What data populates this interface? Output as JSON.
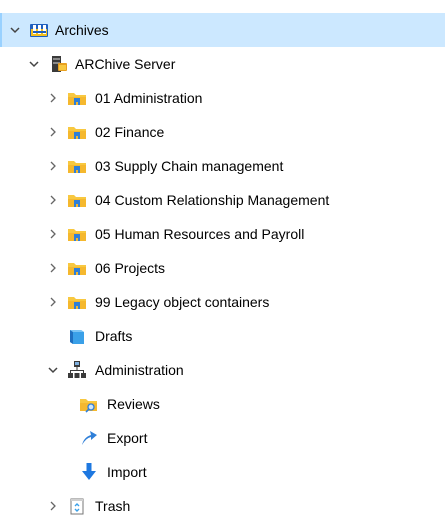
{
  "tree": {
    "root": {
      "label": "Archives",
      "icon": "archives-app-icon",
      "expanded": true,
      "selected": true,
      "selection_color": "#cce8ff"
    },
    "server": {
      "label": "ARChive Server",
      "icon": "archive-server-icon",
      "expanded": true
    },
    "cabinets": [
      {
        "label": "01 Administration",
        "icon": "cabinet-folder-icon",
        "expanded": false
      },
      {
        "label": "02 Finance",
        "icon": "cabinet-folder-icon",
        "expanded": false
      },
      {
        "label": "03 Supply Chain management",
        "icon": "cabinet-folder-icon",
        "expanded": false
      },
      {
        "label": "04 Custom Relationship Management",
        "icon": "cabinet-folder-icon",
        "expanded": false
      },
      {
        "label": "05 Human Resources and Payroll",
        "icon": "cabinet-folder-icon",
        "expanded": false
      },
      {
        "label": "06 Projects",
        "icon": "cabinet-folder-icon",
        "expanded": false
      },
      {
        "label": "99 Legacy object containers",
        "icon": "cabinet-folder-icon",
        "expanded": false
      }
    ],
    "drafts": {
      "label": "Drafts",
      "icon": "drafts-box-icon"
    },
    "administration": {
      "label": "Administration",
      "icon": "network-admin-icon",
      "expanded": true,
      "children": [
        {
          "label": "Reviews",
          "icon": "reviews-folder-icon"
        },
        {
          "label": "Export",
          "icon": "export-arrow-icon"
        },
        {
          "label": "Import",
          "icon": "import-arrow-icon"
        }
      ]
    },
    "trash": {
      "label": "Trash",
      "icon": "trash-bin-icon",
      "expanded": false
    }
  },
  "colors": {
    "folder_yellow": "#f8c840",
    "folder_blue": "#2f7fd8",
    "export_blue": "#2f7fd8",
    "import_blue": "#1e78e0",
    "drafts_blue": "#3aa0e8",
    "chevron": "#444444"
  }
}
